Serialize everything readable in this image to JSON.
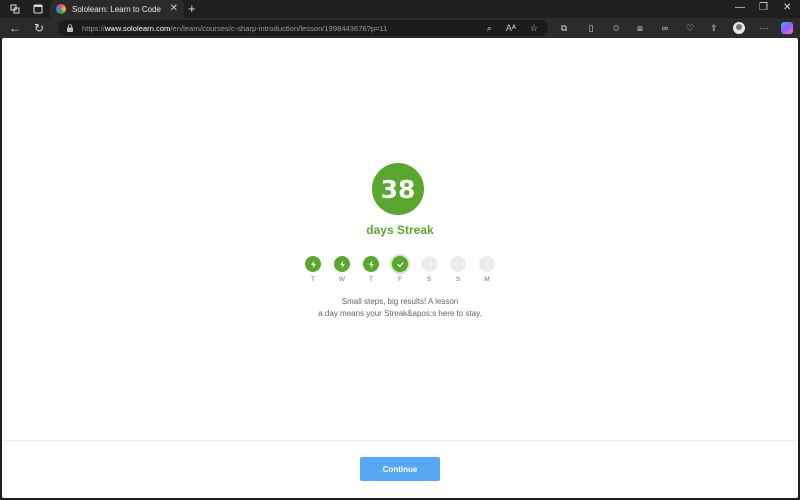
{
  "browser": {
    "tab_title": "Sololearn: Learn to Code",
    "tab_close": "✕",
    "new_tab": "+",
    "url_scheme": "https://",
    "url_host": "www.sololearn.com",
    "url_path": "/en/learn/courses/c-sharp-introduction/lesson/1998443676?p=11",
    "icons": [
      "workspaces-icon",
      "tab-actions-icon",
      "back-icon",
      "refresh-icon",
      "lock-icon",
      "zoom-icon",
      "read-aloud-icon",
      "favorite-icon",
      "extensions-icon",
      "split-screen-icon",
      "favorites-icon",
      "collections-icon",
      "copilot-icon",
      "browser-essentials-icon",
      "share-icon",
      "profile-icon",
      "more-icon"
    ]
  },
  "streak": {
    "count": "38",
    "label": "days Streak",
    "days": [
      {
        "label": "T",
        "state": "done"
      },
      {
        "label": "W",
        "state": "done"
      },
      {
        "label": "T",
        "state": "done"
      },
      {
        "label": "F",
        "state": "today"
      },
      {
        "label": "S",
        "state": "empty"
      },
      {
        "label": "S",
        "state": "empty"
      },
      {
        "label": "M",
        "state": "empty"
      }
    ],
    "message_line1": "Small steps, big results! A lesson",
    "message_line2": "a day means your Streak&apos;s here to stay."
  },
  "footer": {
    "continue_label": "Continue"
  },
  "colors": {
    "accent_green": "#5aa72f",
    "button_blue": "#58a7f5"
  }
}
